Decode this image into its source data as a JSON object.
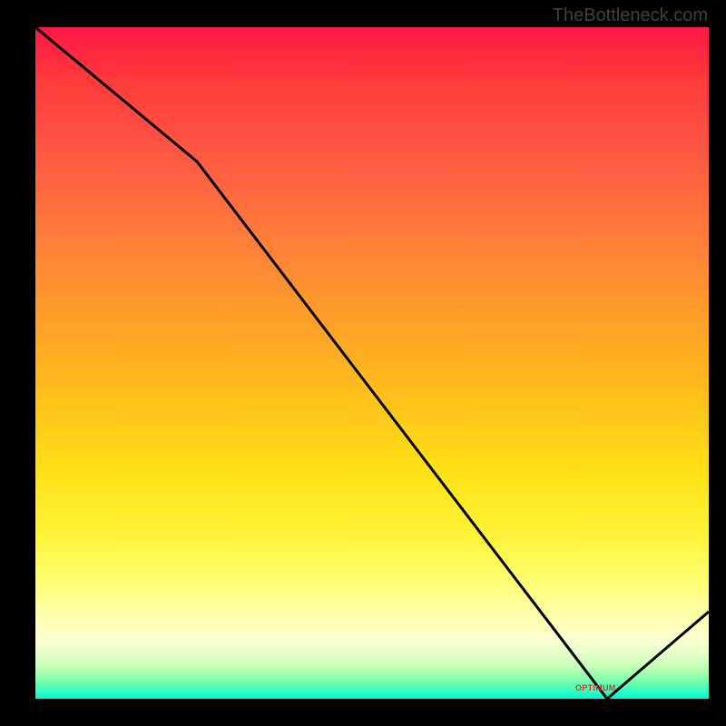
{
  "watermark": "TheBottleneck.com",
  "annotation_label": "OPTIMUM",
  "chart_data": {
    "type": "line",
    "title": "",
    "xlabel": "",
    "ylabel": "",
    "xlim": [
      0,
      100
    ],
    "ylim": [
      0,
      100
    ],
    "x": [
      0,
      24,
      85,
      100
    ],
    "values": [
      100,
      80,
      0,
      13
    ],
    "gradient_colors": {
      "top": "#ff1744",
      "mid_upper": "#ffa028",
      "mid": "#ffe016",
      "mid_lower": "#ffffb0",
      "bottom": "#00f5d4"
    },
    "annotation": {
      "text": "OPTIMUM",
      "x": 85,
      "y": 1
    }
  }
}
